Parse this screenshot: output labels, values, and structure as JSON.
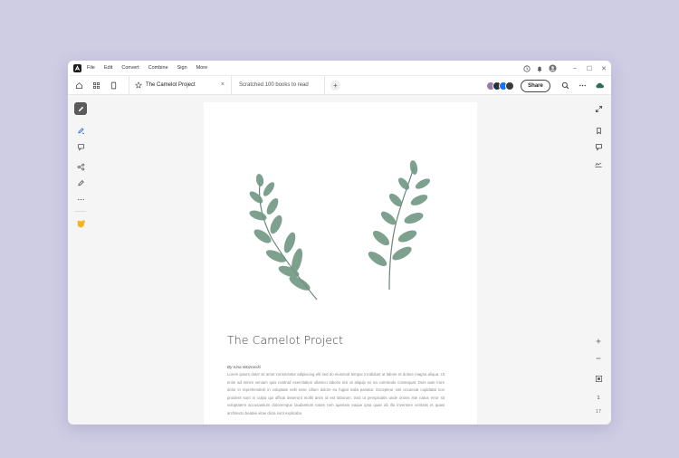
{
  "menu": [
    "File",
    "Edit",
    "Convert",
    "Combine",
    "Sign",
    "More"
  ],
  "tabs": [
    {
      "label": "The Camelot Project",
      "active": true,
      "close": "×"
    },
    {
      "label": "Scratched 100 books to read",
      "active": false
    }
  ],
  "new_tab_label": "+",
  "share_label": "Share",
  "window_controls": {
    "minimize": "–",
    "maximize": "☐",
    "close": "✕"
  },
  "avatars": [
    "#8e7ea8",
    "#2b2f3a",
    "#1a73e8",
    "#3a3a3a"
  ],
  "accent_color": "#2f6fd6",
  "document": {
    "title": "The Camelot Project",
    "author": "By Irina Wozneski",
    "body": "Lorem ipsum dolor sit amet consectetur adipiscing elit sed do eiusmod tempor incididunt ut labore et dolore magna aliqua. Ut enim ad minim veniam quis nostrud exercitation ullamco laboris nisi ut aliquip ex ea commodo consequat. Duis aute irure dolor in reprehenderit in voluptate velit esse cillum dolore eu fugiat nulla pariatur. Excepteur sint occaecat cupidatat non proident sunt in culpa qui officia deserunt mollit anim id est laborum. Sed ut perspiciatis unde omnis iste natus error sit voluptatem accusantium doloremque laudantium totam rem aperiam eaque ipsa quae ab illo inventore veritatis et quasi architecto beatae vitae dicta sunt explicabo."
  },
  "icons": {
    "title_right": [
      "help-icon",
      "bell-icon",
      "profile-icon"
    ],
    "left_tools": [
      "edit-icon",
      "highlight-icon",
      "comment-icon",
      "share-graph-icon",
      "draw-icon",
      "more-icon",
      "stamp-icon"
    ],
    "right_tools": [
      "expand-icon",
      "bookmark-icon",
      "comments-icon",
      "sign-icon",
      "zoom-in-icon",
      "zoom-out-icon",
      "fit-page-icon",
      "page-number-icon",
      "page-total-icon"
    ]
  },
  "page_indicator": {
    "current": "1",
    "total": "17"
  }
}
